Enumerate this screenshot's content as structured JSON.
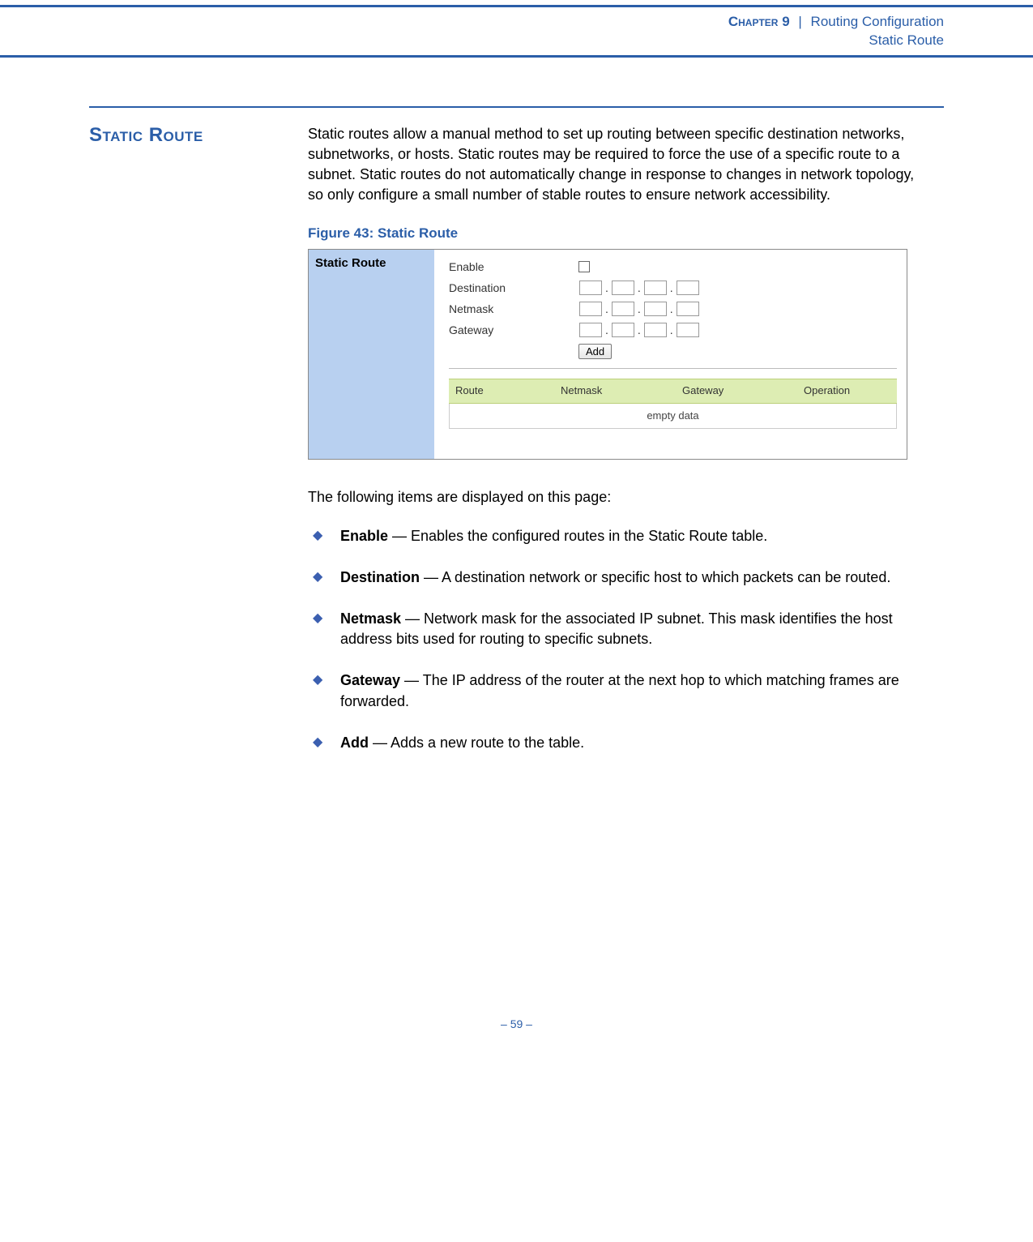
{
  "header": {
    "chapter_label": "Chapter 9",
    "separator": "|",
    "title": "Routing Configuration",
    "subtitle": "Static Route"
  },
  "section": {
    "title": "Static Route",
    "paragraph": "Static routes allow a manual method to set up routing between specific destination networks, subnetworks, or hosts. Static routes may be required to force the use of a specific route to a subnet. Static routes do not automatically change in response to changes in network topology, so only configure a small number of stable routes to ensure network accessibility."
  },
  "figure": {
    "caption": "Figure 43:  Static Route",
    "side_title": "Static Route",
    "form": {
      "enable_label": "Enable",
      "destination_label": "Destination",
      "netmask_label": "Netmask",
      "gateway_label": "Gateway",
      "add_button": "Add"
    },
    "table": {
      "headers": {
        "route": "Route",
        "netmask": "Netmask",
        "gateway": "Gateway",
        "operation": "Operation"
      },
      "empty_text": "empty data"
    }
  },
  "list_intro": "The following items are displayed on this page:",
  "items": [
    {
      "term": "Enable",
      "desc": " — Enables the configured routes in the Static Route table."
    },
    {
      "term": "Destination",
      "desc": " — A destination network or specific host to which packets can be routed."
    },
    {
      "term": "Netmask",
      "desc": " — Network mask for the associated IP subnet. This mask identifies the host address bits used for routing to specific subnets."
    },
    {
      "term": "Gateway",
      "desc": " — The IP address of the router at the next hop to which matching frames are forwarded."
    },
    {
      "term": "Add",
      "desc": " — Adds a new route to the table."
    }
  ],
  "footer": {
    "page_number": "–  59  –"
  }
}
